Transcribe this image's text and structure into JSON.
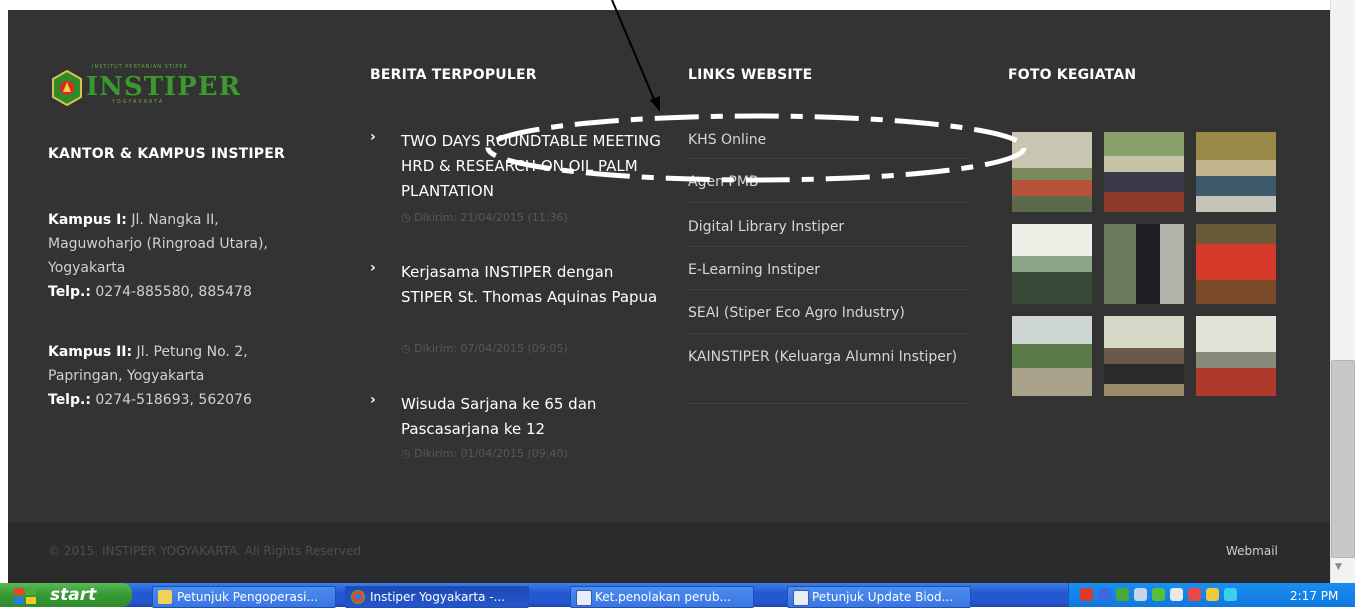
{
  "footer": {
    "logo_text": "INSTIPER",
    "logo_sub_top": "INSTITUT PERTANIAN STIPER",
    "logo_sub_bottom": "YOGYAKARTA",
    "office_heading": "KANTOR & KAMPUS INSTIPER",
    "campus1": {
      "label": "Kampus I:",
      "address_line1": " Jl. Nangka II,",
      "address_line2": "Maguwoharjo (Ringroad Utara),",
      "address_line3": "Yogyakarta",
      "phone_label": "Telp.:",
      "phone": " 0274-885580, 885478"
    },
    "campus2": {
      "label": "Kampus II:",
      "address_line1": " Jl. Petung No. 2,",
      "address_line2": "Papringan, Yogyakarta",
      "phone_label": "Telp.:",
      "phone": " 0274-518693, 562076"
    },
    "news_heading": "BERITA TERPOPULER",
    "news": [
      {
        "title": "TWO DAYS ROUNDTABLE MEETING HRD & RESEARCH ON OIL PALM PLANTATION",
        "date": "Dikirim: 21/04/2015 (11:36)"
      },
      {
        "title": "Kerjasama INSTIPER dengan STIPER St. Thomas Aquinas Papua",
        "date": "Dikirim: 07/04/2015 (09:05)"
      },
      {
        "title": "Wisuda Sarjana ke 65 dan Pascasarjana ke 12",
        "date": "Dikirim: 01/04/2015 (09:40)"
      }
    ],
    "links_heading": "LINKS WEBSITE",
    "links": [
      "KHS Online",
      "Agen PMB",
      "Digital Library Instiper",
      "E-Learning Instiper",
      "SEAI (Stiper Eco Agro Industry)",
      "KAINSTIPER (Keluarga Alumni Instiper)"
    ],
    "photos_heading": "FOTO KEGIATAN",
    "copyright": "© 2015. INSTIPER YOGYAKARTA. All Rights Reserved",
    "webmail": "Webmail"
  },
  "taskbar": {
    "start_label": "start",
    "buttons": [
      "Petunjuk Pengoperasi...",
      "Instiper Yogyakarta -...",
      "Ket.penolakan perub...",
      "Petunjuk Update Biod..."
    ],
    "clock": "2:17 PM"
  },
  "colors": {
    "footer_bg": "#333333",
    "bottom_bar_bg": "#2b2b2b",
    "logo_green": "#3a9a2e",
    "taskbar_blue": "#2457cf",
    "start_green": "#389c34"
  }
}
